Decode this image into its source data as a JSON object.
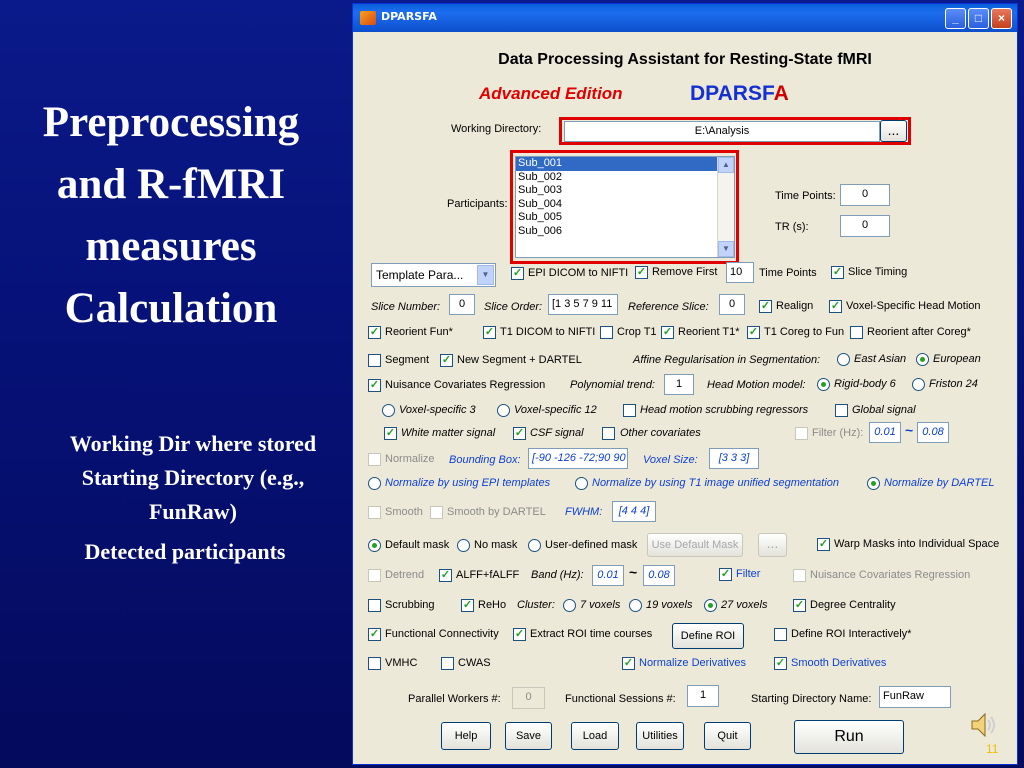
{
  "slide": {
    "title_lines": [
      "Preprocessing",
      "and R-fMRI",
      "measures",
      "Calculation"
    ],
    "caption_working_dir": "Working Dir where stored Starting Directory (e.g., FunRaw)",
    "caption_participants": "Detected participants",
    "page_number": "11"
  },
  "window": {
    "title": "DPARSFA",
    "heading": "Data Processing Assistant for Resting-State fMRI",
    "edition": "Advanced Edition",
    "brand_main": "DPARSF",
    "brand_suffix": "A"
  },
  "working_dir": {
    "label": "Working Directory:",
    "value": "E:\\Analysis",
    "browse": "..."
  },
  "participants": {
    "label": "Participants:",
    "items": [
      "Sub_001",
      "Sub_002",
      "Sub_003",
      "Sub_004",
      "Sub_005",
      "Sub_006"
    ],
    "selected_index": 0
  },
  "time_points": {
    "label": "Time Points:",
    "value": "0"
  },
  "tr": {
    "label": "TR (s):",
    "value": "0"
  },
  "template": {
    "value": "Template Para..."
  },
  "row1": {
    "epi_dicom": "EPI DICOM to NIFTI",
    "remove_first": "Remove First",
    "remove_first_value": "10",
    "time_points": "Time Points",
    "slice_timing": "Slice Timing"
  },
  "row2": {
    "slice_number": "Slice Number:",
    "slice_number_value": "0",
    "slice_order": "Slice Order:",
    "slice_order_value": "[1 3 5 7 9 11",
    "reference_slice": "Reference Slice:",
    "reference_slice_value": "0",
    "realign": "Realign",
    "voxel_specific_hm": "Voxel-Specific Head Motion"
  },
  "row3": {
    "reorient_fun": "Reorient Fun*",
    "t1_dicom": "T1 DICOM to NIFTI",
    "crop_t1": "Crop T1",
    "reorient_t1": "Reorient T1*",
    "t1_coreg": "T1 Coreg to Fun",
    "reorient_after": "Reorient after Coreg*"
  },
  "row4": {
    "segment": "Segment",
    "new_segment": "New Segment + DARTEL",
    "affine": "Affine Regularisation in Segmentation:",
    "east_asian": "East Asian",
    "european": "European"
  },
  "row5": {
    "nuisance": "Nuisance Covariates Regression",
    "poly_trend": "Polynomial trend:",
    "poly_value": "1",
    "hm_model": "Head Motion model:",
    "rigid": "Rigid-body 6",
    "friston": "Friston 24"
  },
  "row6": {
    "voxel3": "Voxel-specific 3",
    "voxel12": "Voxel-specific 12",
    "scrub_reg": "Head motion scrubbing regressors",
    "global": "Global signal"
  },
  "row7": {
    "wm": "White matter signal",
    "csf": "CSF signal",
    "other": "Other covariates",
    "filter": "Filter (Hz):",
    "filter_low": "0.01",
    "tilde": "~",
    "filter_high": "0.08"
  },
  "row8": {
    "normalize": "Normalize",
    "bbox": "Bounding Box:",
    "bbox_value": "[-90 -126 -72;90 90",
    "voxel_size": "Voxel Size:",
    "voxel_size_value": "[3 3 3]"
  },
  "row9": {
    "norm_epi": "Normalize by using EPI templates",
    "norm_t1": "Normalize by using T1 image unified segmentation",
    "norm_dartel": "Normalize by DARTEL"
  },
  "row10": {
    "smooth": "Smooth",
    "smooth_dartel": "Smooth by DARTEL",
    "fwhm": "FWHM:",
    "fwhm_value": "[4 4 4]"
  },
  "row11": {
    "default_mask": "Default mask",
    "no_mask": "No mask",
    "user_mask": "User-defined mask",
    "use_default_mask": "Use Default Mask",
    "browse": "...",
    "warp": "Warp Masks into Individual Space"
  },
  "row12": {
    "detrend": "Detrend",
    "alff": "ALFF+fALFF",
    "band": "Band (Hz):",
    "band_low": "0.01",
    "tilde": "~",
    "band_high": "0.08",
    "filter": "Filter",
    "nuisance": "Nuisance Covariates Regression"
  },
  "row13": {
    "scrubbing": "Scrubbing",
    "reho": "ReHo",
    "cluster": "Cluster:",
    "v7": "7 voxels",
    "v19": "19 voxels",
    "v27": "27 voxels",
    "degree": "Degree Centrality"
  },
  "row14": {
    "fc": "Functional Connectivity",
    "extract_roi": "Extract ROI time courses",
    "define_roi": "Define ROI",
    "define_roi_interactive": "Define ROI Interactively*"
  },
  "row15": {
    "vmhc": "VMHC",
    "cwas": "CWAS",
    "norm_deriv": "Normalize Derivatives",
    "smooth_deriv": "Smooth Derivatives"
  },
  "row16": {
    "parallel": "Parallel Workers #:",
    "parallel_value": "0",
    "sessions": "Functional Sessions #:",
    "sessions_value": "1",
    "start_dir": "Starting Directory Name:",
    "start_dir_value": "FunRaw"
  },
  "buttons": {
    "help": "Help",
    "save": "Save",
    "load": "Load",
    "utilities": "Utilities",
    "quit": "Quit",
    "run": "Run"
  },
  "colors": {
    "background": "#061279",
    "red_highlight": "#e00000",
    "check_green": "#21a121",
    "blue_label": "#0c3fd3",
    "page_number": "#f0c000"
  }
}
